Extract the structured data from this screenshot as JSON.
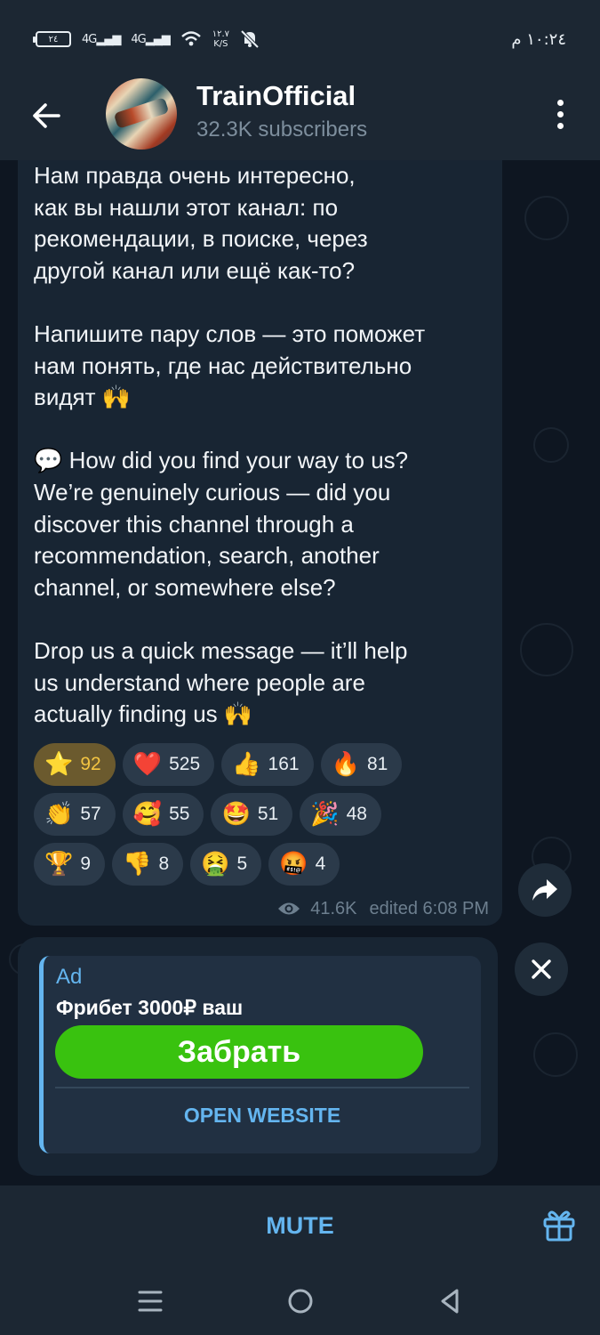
{
  "status_bar": {
    "battery": "٢٤",
    "signal_1": "4G",
    "signal_2": "4G",
    "speed": "١٢.٧",
    "speed_unit": "K/S",
    "time": "١٠:٢٤ م"
  },
  "header": {
    "title": "TrainOfficial",
    "subtitle": "32.3K subscribers"
  },
  "message": {
    "paragraphs": [
      "Нам правда очень интересно,\nкак вы нашли этот канал: по\nрекомендации, в поиске, через\nдругой канал или ещё как-то?",
      "Напишите пару слов — это поможет\nнам понять, где нас действительно\nвидят 🙌",
      "💬 How did you find your way to us?\nWe’re genuinely curious — did you\ndiscover this channel through a\nrecommendation, search, another\nchannel, or somewhere else?",
      "Drop us a quick message — it’ll help\nus understand where people are\nactually finding us 🙌"
    ],
    "views": "41.6K",
    "edited": "edited 6:08 PM"
  },
  "reactions": [
    {
      "emoji": "⭐",
      "count": "92"
    },
    {
      "emoji": "❤️",
      "count": "525"
    },
    {
      "emoji": "👍",
      "count": "161"
    },
    {
      "emoji": "🔥",
      "count": "81"
    },
    {
      "emoji": "👏",
      "count": "57"
    },
    {
      "emoji": "🥰",
      "count": "55"
    },
    {
      "emoji": "🤩",
      "count": "51"
    },
    {
      "emoji": "🎉",
      "count": "48"
    },
    {
      "emoji": "🏆",
      "count": "9"
    },
    {
      "emoji": "👎",
      "count": "8"
    },
    {
      "emoji": "🤮",
      "count": "5"
    },
    {
      "emoji": "🤬",
      "count": "4"
    }
  ],
  "ad": {
    "label": "Ad",
    "title": "Фрибет 3000₽ ваш",
    "cta": "Забрать",
    "open_website": "OPEN WEBSITE"
  },
  "bottom_bar": {
    "mute": "MUTE"
  },
  "icons": {
    "back": "arrow-left-icon",
    "menu": "more-vertical-icon",
    "share": "share-arrow-icon",
    "close": "close-icon",
    "gift": "gift-icon",
    "views": "eye-icon"
  },
  "colors": {
    "accent": "#64b5ef",
    "cta": "#39c20f",
    "background": "#0e1621",
    "bubble": "#182533"
  }
}
